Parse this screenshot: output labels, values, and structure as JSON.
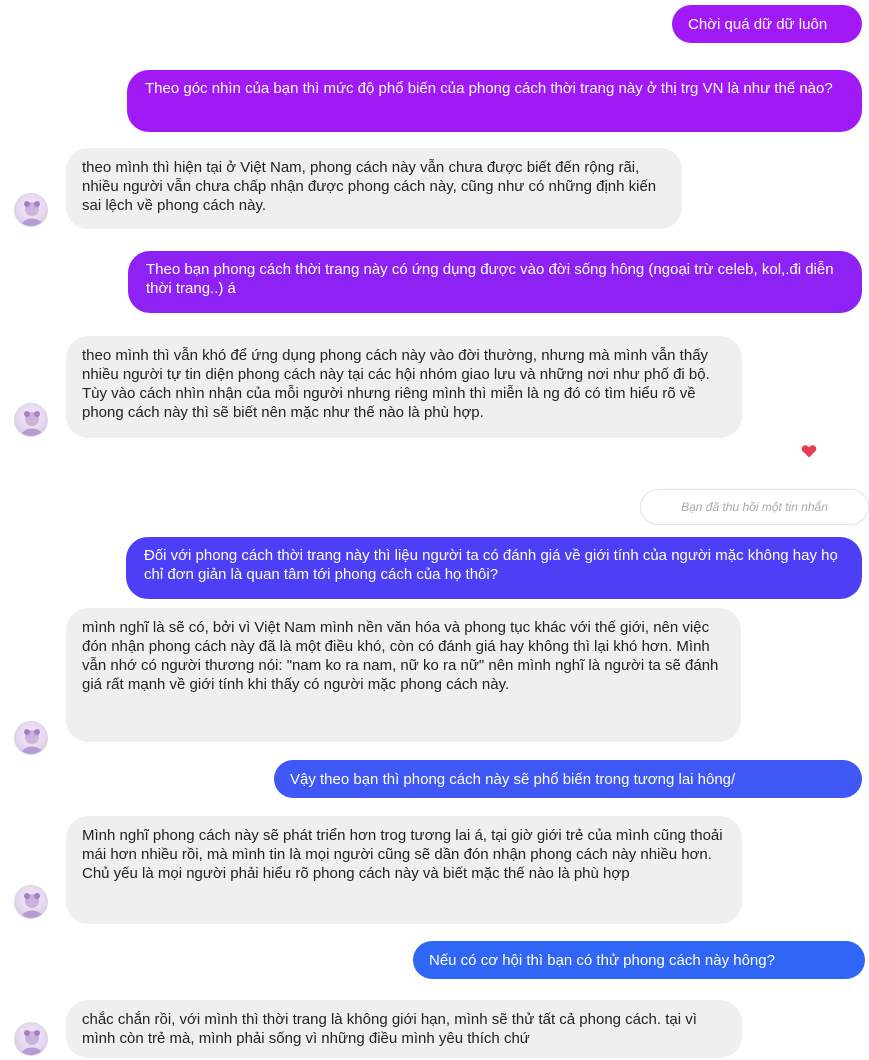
{
  "colors": {
    "outgoing_gradient": [
      "#9a1ff7",
      "#3b5bf5"
    ],
    "incoming_bg": "#efefef",
    "reaction_heart": "#e43f4f"
  },
  "messages": [
    {
      "id": "m1",
      "direction": "outgoing",
      "text": "Chời quá dữ dữ luôn"
    },
    {
      "id": "m2",
      "direction": "outgoing",
      "text": "Theo góc nhìn của bạn thì mức độ phổ biến của phong cách thời trang này ở thị trg VN  là như thế nào?"
    },
    {
      "id": "m3",
      "direction": "incoming",
      "text": "theo mình thì hiện tại ở Việt Nam, phong cách này vẫn chưa được biết đến rộng rãi, nhiều người vẫn chưa chấp nhận được phong cách này, cũng như có những định kiến sai lệch về phong cách này."
    },
    {
      "id": "m4",
      "direction": "outgoing",
      "text": "Theo bạn phong cách thời trang này có ứng dụng được vào đời sống hông (ngoại trừ celeb, kol,.đi diễn thời trang..) á"
    },
    {
      "id": "m5",
      "direction": "incoming",
      "text": "theo mình thì vẫn khó để ứng dụng phong cách này vào đời thường, nhưng mà mình vẫn thấy nhiều người tự tin diện phong cách này tại các hội nhóm giao lưu và những nơi như phố đi bộ. Tùy vào cách nhìn nhận của mỗi người nhưng riêng mình thì miễn là ng đó có tìm hiểu rõ về phong cách này thì sẽ biết nên mặc như thế nào là phù hợp."
    },
    {
      "id": "m6",
      "direction": "system",
      "text": "Bạn đã thu hồi một tin nhắn"
    },
    {
      "id": "m7",
      "direction": "outgoing",
      "text": "Đối với phong cách thời trang này thì liệu người ta có đánh giá về giới tính của người mặc không hay họ chỉ đơn giản là quan tâm tới phong cách của họ thôi?"
    },
    {
      "id": "m8",
      "direction": "incoming",
      "text": "mình nghĩ là sẽ có, bởi vì Việt Nam mình nền văn hóa và phong tục khác với thế giới, nên việc đón nhận phong cách này đã là một điều khó, còn có đánh giá hay không thì lại khó hơn. Mình vẫn nhớ có người thương nói: \"nam ko ra nam, nữ ko ra nữ\" nên mình nghĩ là người ta sẽ đánh giá rất mạnh về giới tính khi thấy có người mặc phong cách này."
    },
    {
      "id": "m9",
      "direction": "outgoing",
      "text": "Vậy theo bạn thì phong cách này sẽ phổ biến trong tương lai hông/"
    },
    {
      "id": "m10",
      "direction": "incoming",
      "text": "Mình nghĩ phong cách này sẽ phát triển hơn trog tương lai á, tại giờ giới trẻ của mình cũng thoải mái hơn nhiều rồi, mà mình tin là mọi người cũng sẽ dần đón nhận phong cách này nhiều hơn. Chủ yếu là mọi người phải hiểu rõ phong cách này và biết mặc thế nào là phù hợp"
    },
    {
      "id": "m11",
      "direction": "outgoing",
      "text": "Nếu có cơ hội thì bạn có thử phong cách này hông?"
    },
    {
      "id": "m12",
      "direction": "incoming",
      "text": "chắc chắn rồi, với mình thì thời trang là không giới hạn, mình sẽ thử tất cả phong cách. tại vì mình còn trẻ mà, mình phải sống vì những điều mình yêu thích chứ"
    }
  ]
}
